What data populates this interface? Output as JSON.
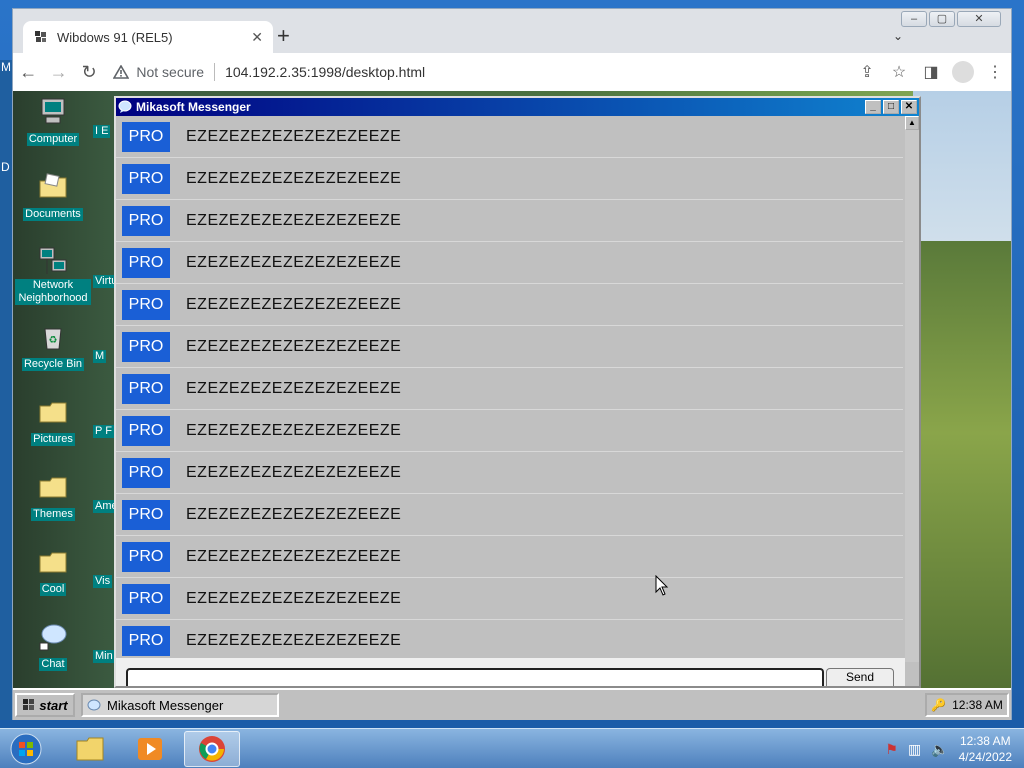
{
  "host": {
    "left_letters": [
      "M",
      "D"
    ]
  },
  "browser": {
    "tab_title": "Wibdows 91 (REL5)",
    "not_secure": "Not secure",
    "url": "104.192.2.35:1998/desktop.html"
  },
  "desktop_icons": [
    {
      "label": "Computer"
    },
    {
      "label": "Documents"
    },
    {
      "label": "Network Neighborhood"
    },
    {
      "label": "Recycle Bin"
    },
    {
      "label": "Pictures"
    },
    {
      "label": "Themes"
    },
    {
      "label": "Cool"
    },
    {
      "label": "Chat"
    }
  ],
  "desktop_icons_col2": [
    "I E",
    "",
    "Virtu",
    "M",
    "P F",
    "Ame",
    "Vis",
    "Min"
  ],
  "messenger": {
    "title": "Mikasoft Messenger",
    "messages": [
      {
        "badge": "PRO",
        "text": "EZEZEZEZEZEZEZEZEEZE"
      },
      {
        "badge": "PRO",
        "text": "EZEZEZEZEZEZEZEZEEZE"
      },
      {
        "badge": "PRO",
        "text": "EZEZEZEZEZEZEZEZEEZE"
      },
      {
        "badge": "PRO",
        "text": "EZEZEZEZEZEZEZEZEEZE"
      },
      {
        "badge": "PRO",
        "text": "EZEZEZEZEZEZEZEZEEZE"
      },
      {
        "badge": "PRO",
        "text": "EZEZEZEZEZEZEZEZEEZE"
      },
      {
        "badge": "PRO",
        "text": "EZEZEZEZEZEZEZEZEEZE"
      },
      {
        "badge": "PRO",
        "text": "EZEZEZEZEZEZEZEZEEZE"
      },
      {
        "badge": "PRO",
        "text": "EZEZEZEZEZEZEZEZEEZE"
      },
      {
        "badge": "PRO",
        "text": "EZEZEZEZEZEZEZEZEEZE"
      },
      {
        "badge": "PRO",
        "text": "EZEZEZEZEZEZEZEZEEZE"
      },
      {
        "badge": "PRO",
        "text": "EZEZEZEZEZEZEZEZEEZE"
      },
      {
        "badge": "PRO",
        "text": "EZEZEZEZEZEZEZEZEEZE"
      }
    ],
    "send_label": "Send"
  },
  "w93_taskbar": {
    "start_label": "start",
    "task_label": "Mikasoft Messenger",
    "clock": "12:38 AM"
  },
  "w7_taskbar": {
    "time": "12:38 AM",
    "date": "4/24/2022"
  },
  "colors": {
    "pro_badge": "#1a5fd6",
    "titlebar_start": "#000080",
    "titlebar_end": "#1084d0",
    "desktop_label_bg": "#008080"
  }
}
